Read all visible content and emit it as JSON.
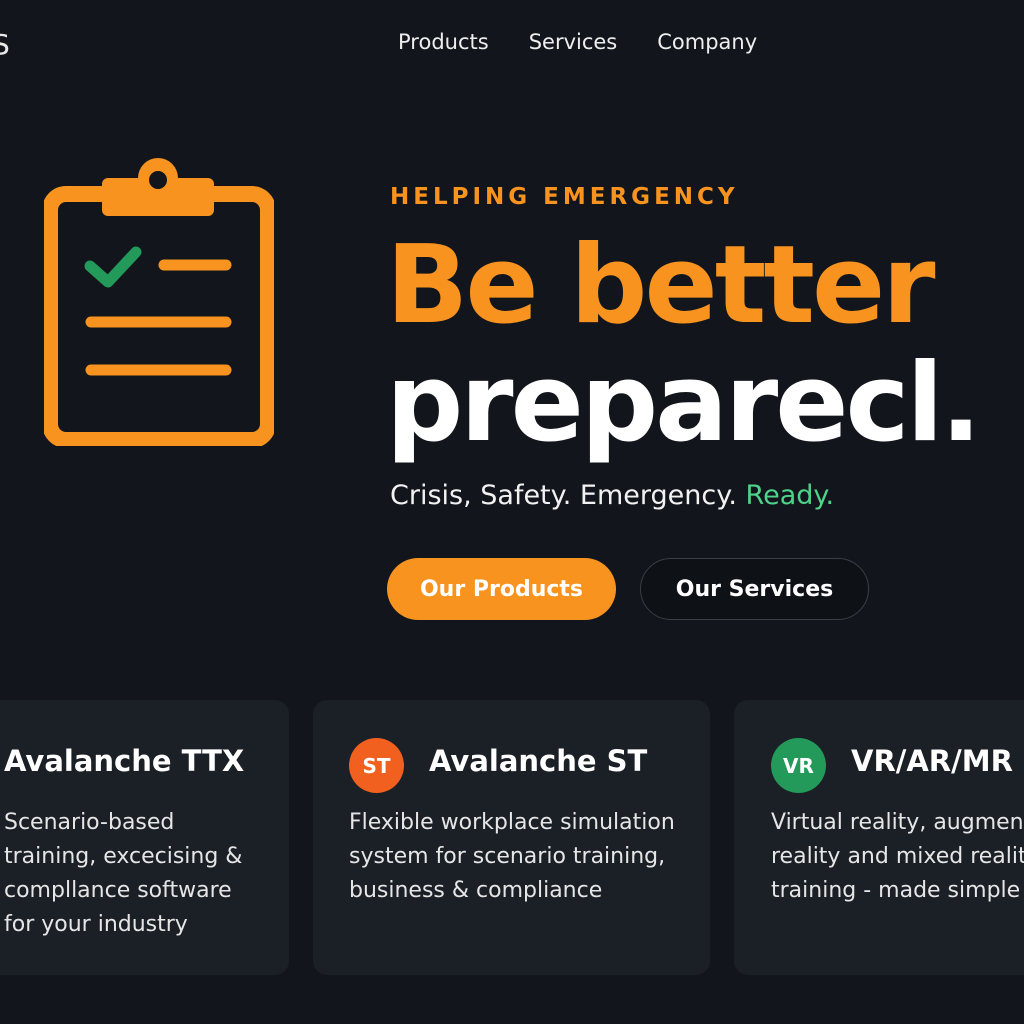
{
  "header": {
    "logo_fragment": "S",
    "nav": [
      "Products",
      "Services",
      "Company"
    ]
  },
  "hero": {
    "eyebrow": "HELPING EMERGENCY",
    "headline_line1": "Be better",
    "headline_line2": "preparecl.",
    "tagline_main": "Crisis, Safety. Emergency.",
    "tagline_accent": "Ready.",
    "primary_button": "Our Products",
    "secondary_button": "Our Services",
    "illustration_icon": "clipboard-checklist-icon"
  },
  "cards": [
    {
      "badge": "",
      "title": "Avalanche TTX",
      "description": "Scenario-based\ntraining, excecising &\ncompllance software\nfor your industry"
    },
    {
      "badge": "ST",
      "title": "Avalanche ST",
      "description": "Flexible workplace simulation\nsystem for scenario training,\nbusiness & compliance"
    },
    {
      "badge": "VR",
      "title": "VR/AR/MR",
      "description": "Virtual reality, augment\nreality and mixed reality\ntraining - made simple"
    }
  ],
  "colors": {
    "background": "#12161c",
    "accent_orange": "#f7931e",
    "accent_green": "#4ed38a",
    "card": "#1b1f26",
    "badge_st": "#f2601f",
    "badge_vr": "#23995a"
  }
}
